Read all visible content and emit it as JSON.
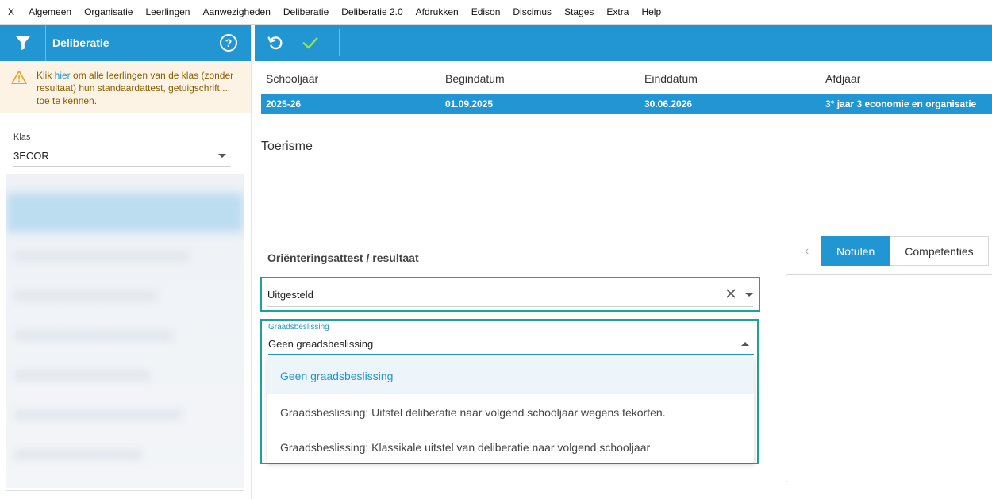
{
  "menu": [
    "X",
    "Algemeen",
    "Organisatie",
    "Leerlingen",
    "Aanwezigheden",
    "Deliberatie",
    "Deliberatie 2.0",
    "Afdrukken",
    "Edison",
    "Discimus",
    "Stages",
    "Extra",
    "Help"
  ],
  "sidebar": {
    "title": "Deliberatie",
    "help_glyph": "?",
    "warning": {
      "before": "Klik ",
      "link": "hier",
      "after": " om alle leerlingen van de klas (zonder resultaat) hun standaardattest, getuigschrift,... toe te kennen."
    },
    "klas_label": "Klas",
    "klas_value": "3ECOR"
  },
  "info": {
    "headers": [
      "Schooljaar",
      "Begindatum",
      "Einddatum",
      "Afdjaar"
    ],
    "row": [
      "2025-26",
      "01.09.2025",
      "30.06.2026",
      "3° jaar 3 economie en organisatie"
    ]
  },
  "section_title": "Toerisme",
  "tabs": {
    "prev_glyph": "‹",
    "items": [
      "Notulen",
      "Competenties"
    ],
    "active": "Notulen"
  },
  "orientation": {
    "title": "Oriënteringsattest / resultaat",
    "value": "Uitgesteld"
  },
  "graads": {
    "label": "Graadsbeslissing",
    "value": "Geen graadsbeslissing",
    "options": [
      "Geen graadsbeslissing",
      "Graadsbeslissing: Uitstel deliberatie naar volgend schooljaar wegens tekorten.",
      "Graadsbeslissing: Klassikale uitstel van deliberatie naar volgend schooljaar"
    ]
  },
  "colors": {
    "primary": "#2196d3",
    "highlight_border": "#1aa39a",
    "warning_bg": "#fcf3e4"
  },
  "icons": {
    "filter": "filter-icon",
    "help": "help-icon",
    "undo": "undo-icon",
    "save": "checkmark-icon",
    "warning": "warning-icon",
    "clear": "close-icon"
  }
}
